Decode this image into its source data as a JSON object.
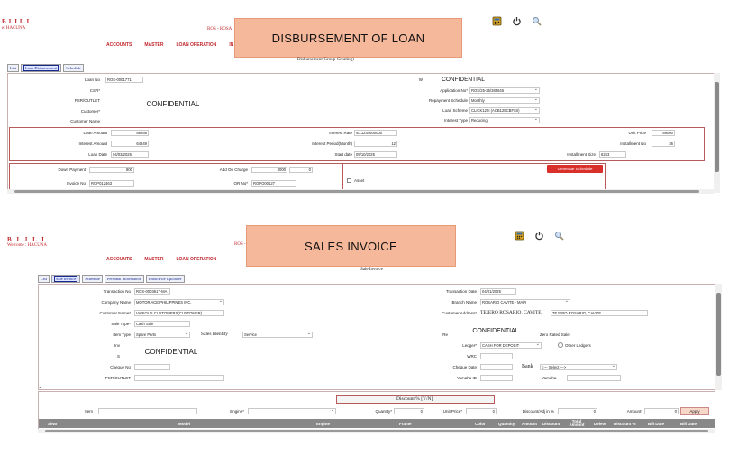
{
  "brand": "BIJLI",
  "brand_spaced": "B I J L I",
  "top": {
    "welcome": "e: HACUNA",
    "company": "ROS - ROSA",
    "menu": [
      "ACCOUNTS",
      "MASTER",
      "LOAN OPERATION",
      "IN"
    ],
    "banner": "DISBURSEMENT OF LOAN",
    "subhead": "Disbursement(Group-Creating)",
    "tabs": [
      "List",
      "Loan Disbursement",
      "Schedule"
    ],
    "confidential_label": "CONFIDENTIAL",
    "fields": {
      "loan_no_label": "Loan No",
      "loan_no": "ROS-0001771",
      "csr_label": "CSR*",
      "psr_label": "PSR/OUTLET",
      "customer_label": "Customer*",
      "customer_name_label": "Customer Name",
      "w_label": "W",
      "application_no_label": "Application No*",
      "application_no": "ROS/25-25/385645",
      "repayment_label": "Repayment Schedule",
      "repayment": "Monthly",
      "loan_scheme_label": "Loan Scheme",
      "loan_scheme": "CLICK125I (ACB125CBFSII)",
      "interest_type_label": "Interest Type",
      "interest_type": "Reducing",
      "loan_amount_label": "Loan Amount",
      "loan_amount": "88268",
      "interest_amount_label": "Interest Amount",
      "interest_amount": "64849",
      "loan_date_label": "Loan Date",
      "loan_date": "04/03/2025",
      "interest_rate_label": "Interest Rate",
      "interest_rate": "40.1244600000",
      "interest_period_label": "Interest Period(Month)",
      "interest_period": "12",
      "start_date_label": "Start date",
      "start_date": "05/10/2025",
      "unit_price_label": "Unit Price",
      "unit_price": "89060",
      "installment_no_label": "Installment No",
      "installment_no": "36",
      "installment_size_label": "Installment Size",
      "installment_size": "6253",
      "down_payment_label": "Down Payment",
      "down_payment": "800",
      "add_on_charge_label": "Add On Charge",
      "add_on_charge": "3000",
      "add_on_extra": "0",
      "invoice_no_label": "Invoice No",
      "invoice_no": "ROP012463",
      "or_no_label": "OR No*",
      "or_no": "ROPO00127",
      "asset_label": "Asset"
    },
    "generate_button": "Generate Schedule"
  },
  "bottom": {
    "brand": "B I J L I",
    "welcome": "Welcome : HACUNA",
    "company": "ROS - RO",
    "menu": [
      "ACCOUNTS",
      "MASTER",
      "LOAN OPERATION"
    ],
    "banner": "SALES INVOICE",
    "subhead": "Sale Invoice",
    "tabs": [
      "List",
      "Sale Invoice",
      "Schedule",
      "Personal Information",
      "Photo File Uploader"
    ],
    "confidential_label": "CONFIDENTIAL",
    "fields": {
      "transaction_no_label": "Transaction No",
      "transaction_no": "ROS-0003617-MA",
      "company_name_label": "Company Name",
      "company_name": "MOTOR ACE PHILIPPINES INC.",
      "customer_name_label": "Customer Name*",
      "customer_name": "VARIOUS CUSTOMERS(CUSTOMER)",
      "sale_type_label": "Sale Type*",
      "sale_type": "Cash Sale",
      "item_type_label": "Item Type",
      "item_type": "Spare Parts",
      "sales_identity_label": "Sales Identity",
      "sales_identity": "Service",
      "inv_label": "Inv",
      "s_label": "S",
      "cheque_no_label": "Cheque No",
      "psr_label": "PSR/OUTLET",
      "transaction_date_label": "Transaction Date",
      "transaction_date": "04/01/2025",
      "branch_name_label": "Branch Name",
      "branch_name": "ROSARIO CAVITE - MAPI",
      "customer_address_label": "Customer Address*",
      "customer_address": "TEJERO ROSARIO, CAVITE",
      "customer_address_field": "TEJERO ROSARIO, CAVITE",
      "re_label": "Re",
      "zero_rated_label": "Zero Rated Sale",
      "ledger_label": "Ledger*",
      "ledger": "CASH FOR DEPOSIT",
      "other_ledgers_label": "Other Ledgers",
      "wrc_label": "WRC",
      "cheque_date_label": "Cheque Date",
      "bank_label": "Bank",
      "bank": "<--- Select --->",
      "yamaha_id_label": "Yamaha ID",
      "yamaha_label": "Yamaha"
    },
    "discount_label": "Discount % [Y/N]",
    "item_row": {
      "item_label": "Item",
      "engine_label": "Engine*",
      "quantity_label": "Quantity*",
      "quantity": "0",
      "unit_price_label": "Unit Price*",
      "unit_price": "0",
      "discount_label": "Discount/Adj in %",
      "discount": "0",
      "amount_label": "Amount*",
      "amount": "0",
      "apply_button": "Apply"
    },
    "grid_columns": [
      "SlNo",
      "Model",
      "Engine",
      "Frame",
      "Color",
      "Quantity",
      "Amount",
      "Discount",
      "Total Amount",
      "Delete",
      "Discount %",
      "Bill Date",
      "Bill Date"
    ]
  }
}
